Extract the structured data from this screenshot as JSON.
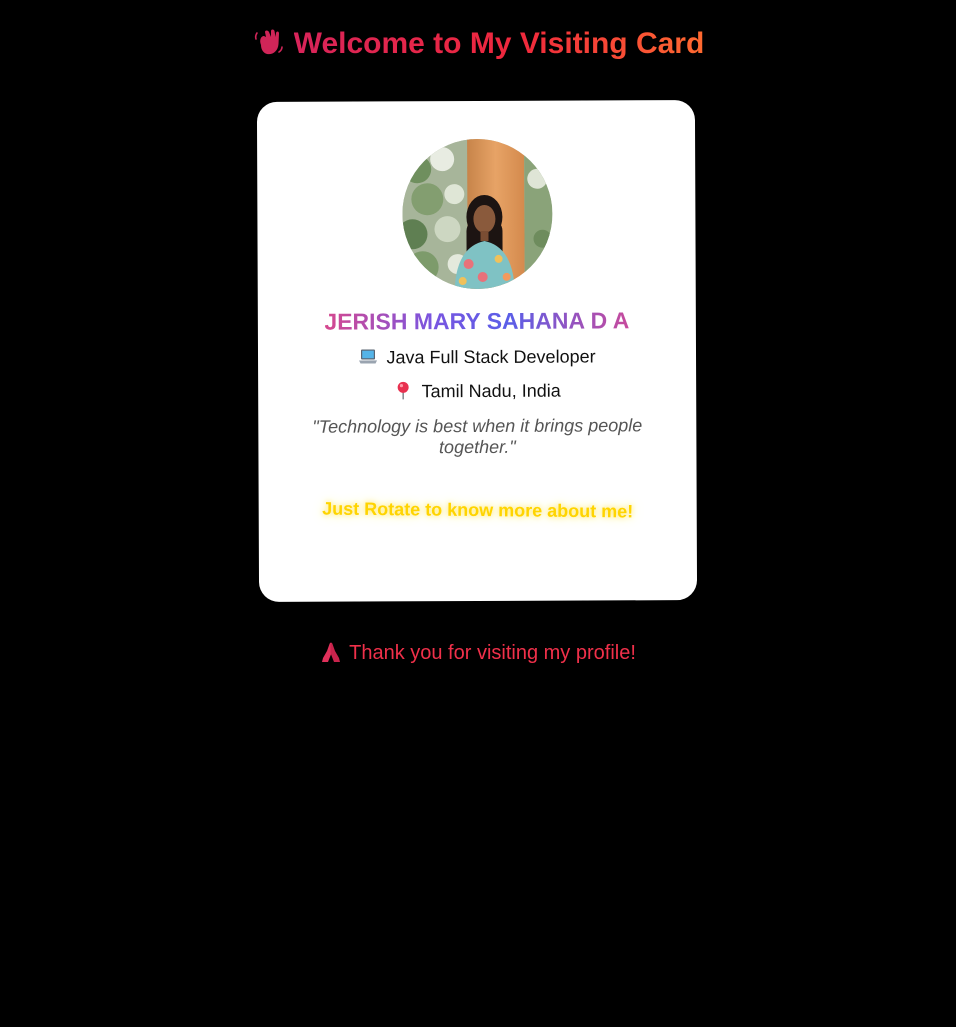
{
  "header": {
    "title": "Welcome to My Visiting Card",
    "icon": "waving-hand-icon"
  },
  "card": {
    "avatar_icon": "profile-photo",
    "name": "JERISH MARY SAHANA D A",
    "role": {
      "icon": "laptop-icon",
      "text": "Java Full Stack Developer"
    },
    "location": {
      "icon": "pin-icon",
      "text": "Tamil Nadu, India"
    },
    "quote": "\"Technology is best when it brings people together.\"",
    "hint": "Just Rotate to know more about me!"
  },
  "footer": {
    "icon": "praying-hands-icon",
    "text": "Thank you for visiting my profile!"
  },
  "colors": {
    "background": "#000000",
    "card": "#ffffff",
    "title_start": "#d8245a",
    "title_end": "#ff6a30",
    "hint": "#ffd400",
    "thanks": "#f0304a"
  }
}
